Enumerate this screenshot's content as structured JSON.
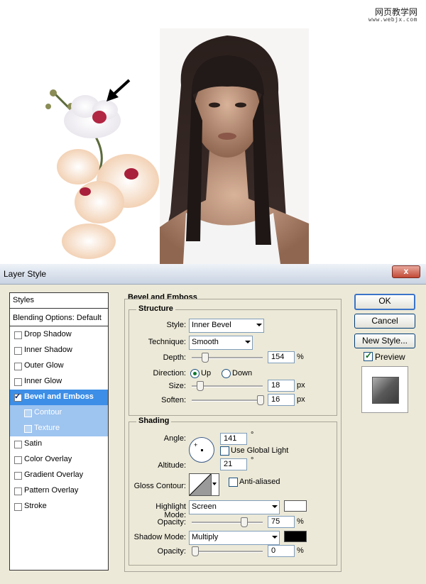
{
  "watermark": {
    "line1": "网页教学网",
    "line2": "www.webjx.com"
  },
  "dialog": {
    "title": "Layer Style",
    "close_label": "x",
    "styles_list": {
      "header": "Styles",
      "blending": "Blending Options: Default",
      "items": [
        {
          "label": "Drop Shadow",
          "checked": false
        },
        {
          "label": "Inner Shadow",
          "checked": false
        },
        {
          "label": "Outer Glow",
          "checked": false
        },
        {
          "label": "Inner Glow",
          "checked": false
        },
        {
          "label": "Bevel and Emboss",
          "checked": true,
          "selected": true
        },
        {
          "label": "Contour",
          "checked": false,
          "sub": true
        },
        {
          "label": "Texture",
          "checked": false,
          "sub": true
        },
        {
          "label": "Satin",
          "checked": false
        },
        {
          "label": "Color Overlay",
          "checked": false
        },
        {
          "label": "Gradient Overlay",
          "checked": false
        },
        {
          "label": "Pattern Overlay",
          "checked": false
        },
        {
          "label": "Stroke",
          "checked": false
        }
      ]
    },
    "panel_title": "Bevel and Emboss",
    "structure": {
      "title": "Structure",
      "style_label": "Style:",
      "style_value": "Inner Bevel",
      "technique_label": "Technique:",
      "technique_value": "Smooth",
      "depth_label": "Depth:",
      "depth_value": "154",
      "depth_unit": "%",
      "depth_level": 0.154,
      "direction_label": "Direction:",
      "direction_up": "Up",
      "direction_down": "Down",
      "direction_selected": "Up",
      "size_label": "Size:",
      "size_value": "18",
      "size_unit": "px",
      "size_level": 0.072,
      "soften_label": "Soften:",
      "soften_value": "16",
      "soften_unit": "px",
      "soften_level": 1.0
    },
    "shading": {
      "title": "Shading",
      "angle_label": "Angle:",
      "angle_value": "141",
      "angle_unit": "°",
      "global_light_label": "Use Global Light",
      "global_light_checked": false,
      "altitude_label": "Altitude:",
      "altitude_value": "21",
      "altitude_unit": "°",
      "gloss_label": "Gloss Contour:",
      "anti_aliased_label": "Anti-aliased",
      "anti_aliased_checked": false,
      "highlight_mode_label": "Highlight Mode:",
      "highlight_mode_value": "Screen",
      "highlight_color": "#ffffff",
      "highlight_opacity_label": "Opacity:",
      "highlight_opacity_value": "75",
      "highlight_opacity_unit": "%",
      "highlight_opacity_level": 0.75,
      "shadow_mode_label": "Shadow Mode:",
      "shadow_mode_value": "Multiply",
      "shadow_color": "#000000",
      "shadow_opacity_label": "Opacity:",
      "shadow_opacity_value": "0",
      "shadow_opacity_unit": "%",
      "shadow_opacity_level": 0.0
    },
    "buttons": {
      "ok": "OK",
      "cancel": "Cancel",
      "new_style": "New Style...",
      "preview": "Preview"
    },
    "preview_checked": true
  }
}
